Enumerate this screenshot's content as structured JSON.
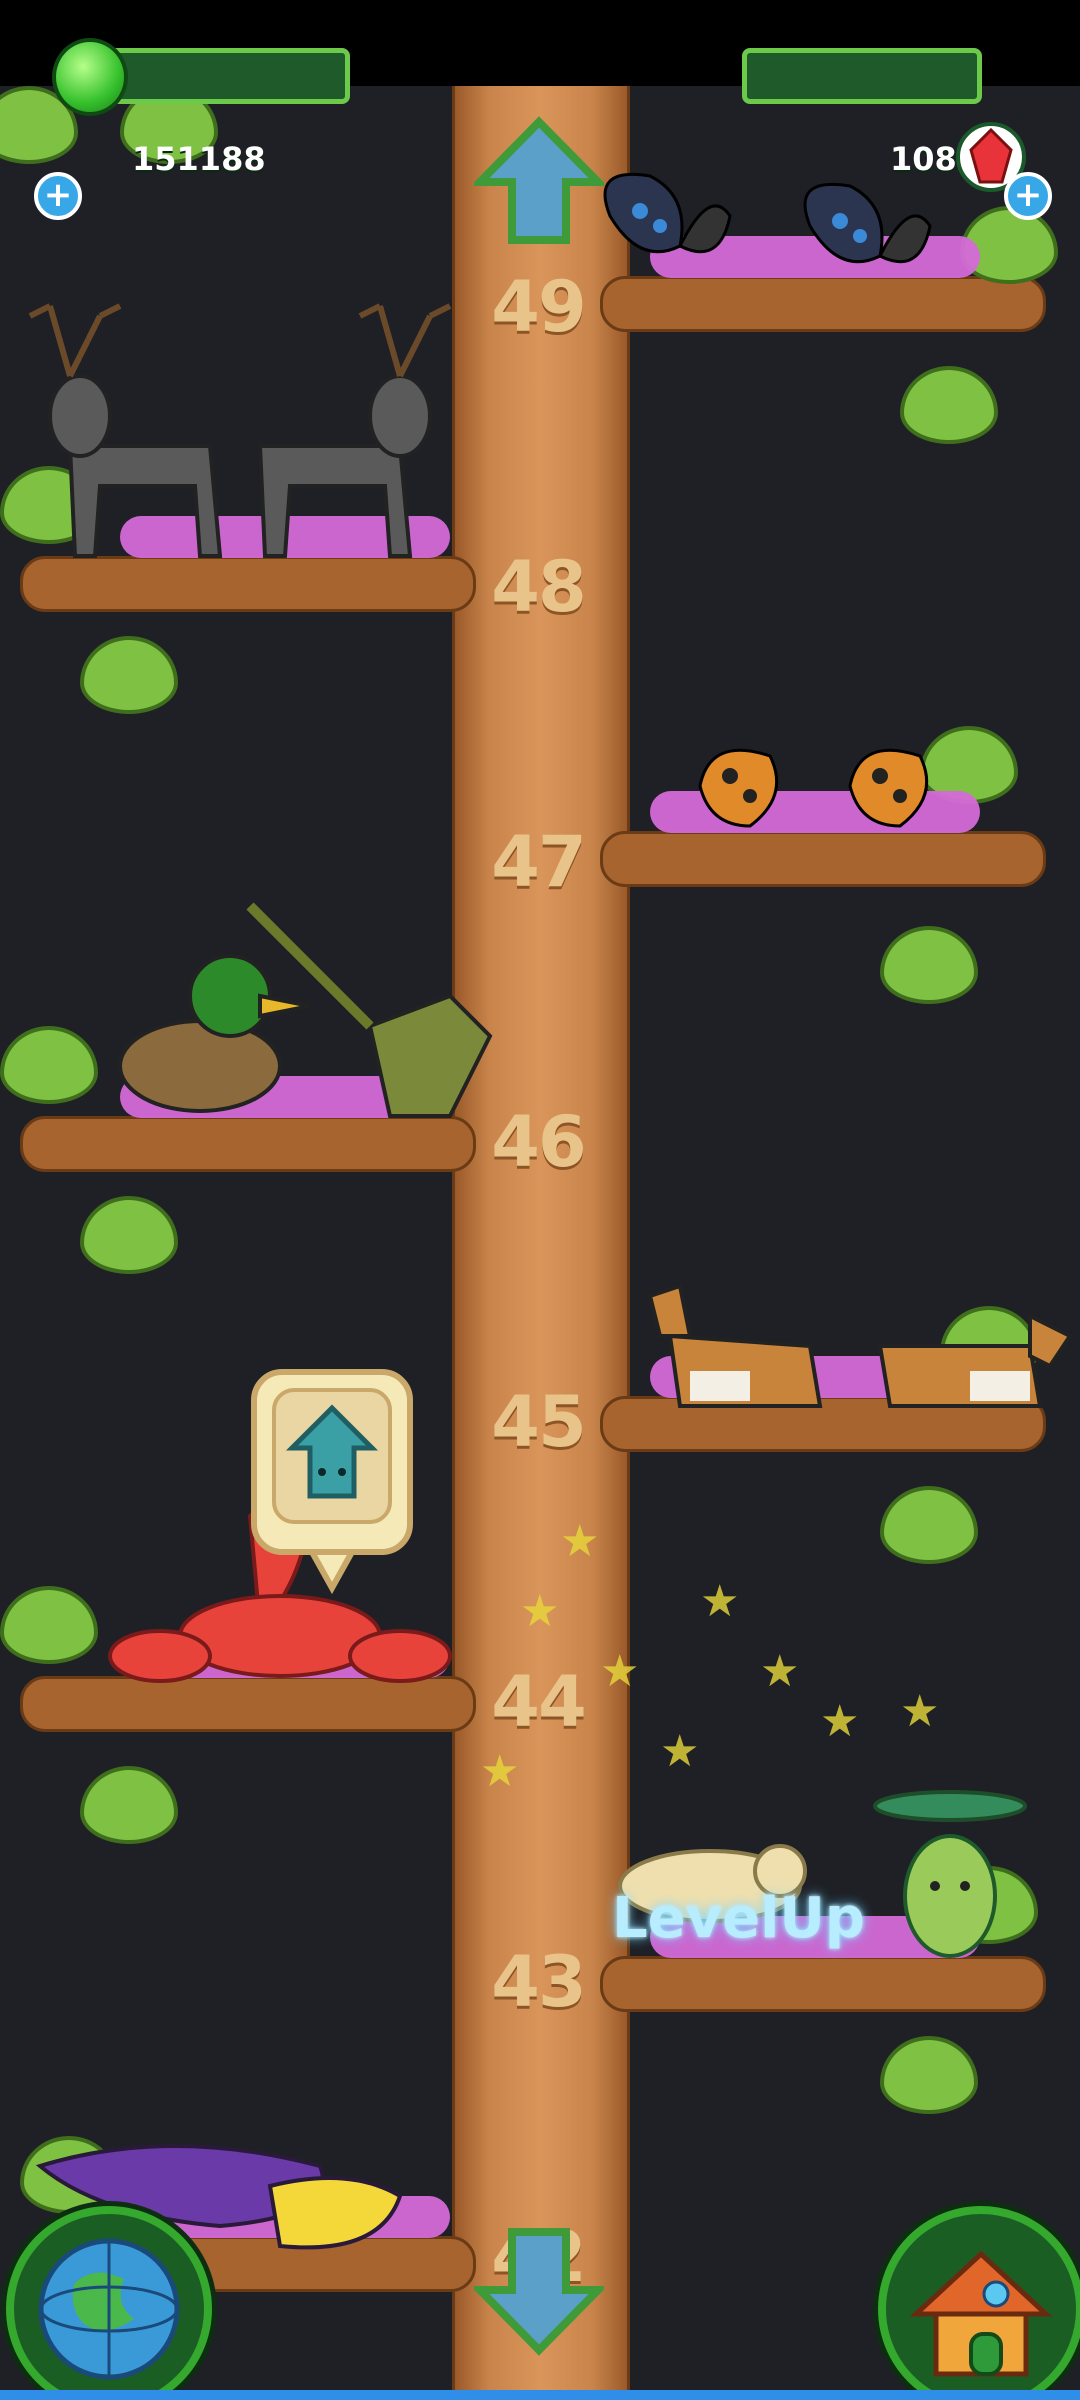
{
  "hud": {
    "currency_value": "151188",
    "premium_value": "108",
    "currency_icon": "green-gem-icon",
    "premium_icon": "red-crystal-icon"
  },
  "tree": {
    "levels": [
      "49",
      "48",
      "47",
      "46",
      "45",
      "44",
      "43",
      "42"
    ]
  },
  "effects": {
    "levelup_text": "LevelUp"
  },
  "navigation": {
    "up_icon": "up-arrow-icon",
    "down_icon": "down-arrow-icon",
    "globe_icon": "globe-icon",
    "home_icon": "house-icon"
  },
  "colors": {
    "trunk": "#c8844a",
    "leaf": "#7fc143",
    "flowers": "#d56ad8",
    "background": "#1e2026"
  },
  "creatures": [
    {
      "level": "49",
      "name": "butterflies-blue"
    },
    {
      "level": "48",
      "name": "reindeer"
    },
    {
      "level": "47",
      "name": "butterflies-orange"
    },
    {
      "level": "46",
      "name": "duck-and-dinosaur"
    },
    {
      "level": "45",
      "name": "corgis"
    },
    {
      "level": "44",
      "name": "lobster"
    },
    {
      "level": "43",
      "name": "seal-and-sprite"
    },
    {
      "level": "42",
      "name": "whale"
    }
  ]
}
